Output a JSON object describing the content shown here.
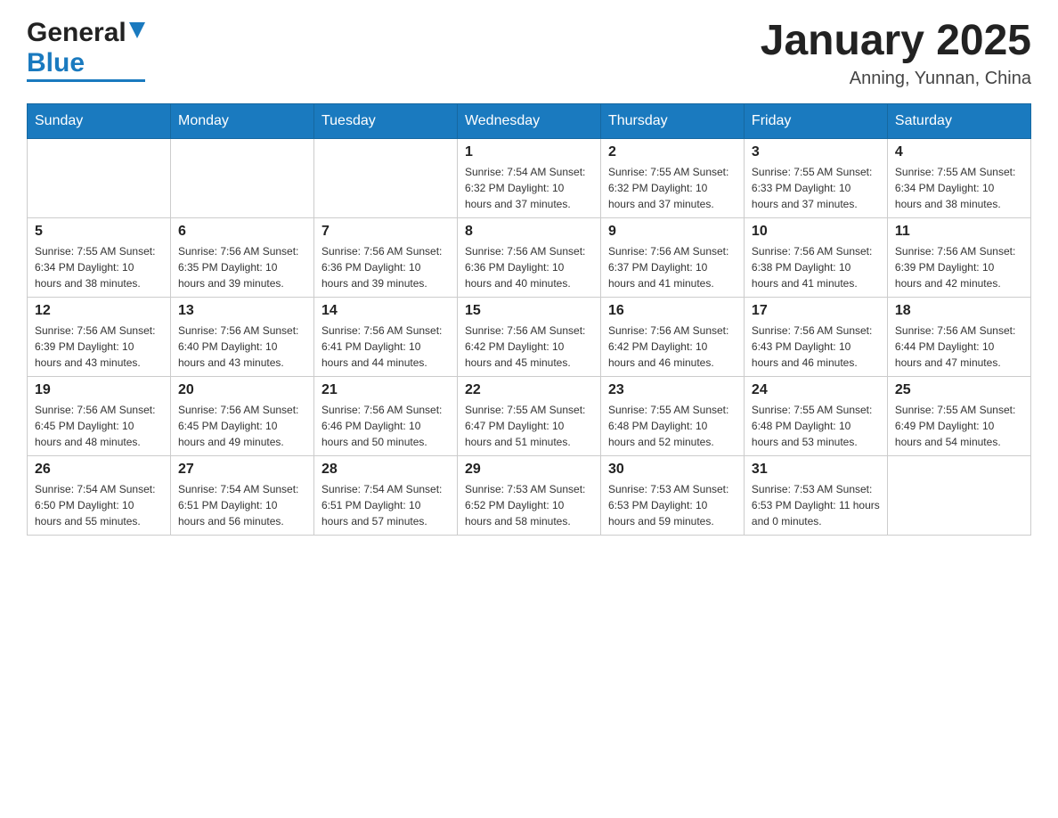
{
  "header": {
    "logo_general": "General",
    "logo_blue": "Blue",
    "title": "January 2025",
    "subtitle": "Anning, Yunnan, China"
  },
  "days_of_week": [
    "Sunday",
    "Monday",
    "Tuesday",
    "Wednesday",
    "Thursday",
    "Friday",
    "Saturday"
  ],
  "weeks": [
    [
      {
        "day": "",
        "info": ""
      },
      {
        "day": "",
        "info": ""
      },
      {
        "day": "",
        "info": ""
      },
      {
        "day": "1",
        "info": "Sunrise: 7:54 AM\nSunset: 6:32 PM\nDaylight: 10 hours\nand 37 minutes."
      },
      {
        "day": "2",
        "info": "Sunrise: 7:55 AM\nSunset: 6:32 PM\nDaylight: 10 hours\nand 37 minutes."
      },
      {
        "day": "3",
        "info": "Sunrise: 7:55 AM\nSunset: 6:33 PM\nDaylight: 10 hours\nand 37 minutes."
      },
      {
        "day": "4",
        "info": "Sunrise: 7:55 AM\nSunset: 6:34 PM\nDaylight: 10 hours\nand 38 minutes."
      }
    ],
    [
      {
        "day": "5",
        "info": "Sunrise: 7:55 AM\nSunset: 6:34 PM\nDaylight: 10 hours\nand 38 minutes."
      },
      {
        "day": "6",
        "info": "Sunrise: 7:56 AM\nSunset: 6:35 PM\nDaylight: 10 hours\nand 39 minutes."
      },
      {
        "day": "7",
        "info": "Sunrise: 7:56 AM\nSunset: 6:36 PM\nDaylight: 10 hours\nand 39 minutes."
      },
      {
        "day": "8",
        "info": "Sunrise: 7:56 AM\nSunset: 6:36 PM\nDaylight: 10 hours\nand 40 minutes."
      },
      {
        "day": "9",
        "info": "Sunrise: 7:56 AM\nSunset: 6:37 PM\nDaylight: 10 hours\nand 41 minutes."
      },
      {
        "day": "10",
        "info": "Sunrise: 7:56 AM\nSunset: 6:38 PM\nDaylight: 10 hours\nand 41 minutes."
      },
      {
        "day": "11",
        "info": "Sunrise: 7:56 AM\nSunset: 6:39 PM\nDaylight: 10 hours\nand 42 minutes."
      }
    ],
    [
      {
        "day": "12",
        "info": "Sunrise: 7:56 AM\nSunset: 6:39 PM\nDaylight: 10 hours\nand 43 minutes."
      },
      {
        "day": "13",
        "info": "Sunrise: 7:56 AM\nSunset: 6:40 PM\nDaylight: 10 hours\nand 43 minutes."
      },
      {
        "day": "14",
        "info": "Sunrise: 7:56 AM\nSunset: 6:41 PM\nDaylight: 10 hours\nand 44 minutes."
      },
      {
        "day": "15",
        "info": "Sunrise: 7:56 AM\nSunset: 6:42 PM\nDaylight: 10 hours\nand 45 minutes."
      },
      {
        "day": "16",
        "info": "Sunrise: 7:56 AM\nSunset: 6:42 PM\nDaylight: 10 hours\nand 46 minutes."
      },
      {
        "day": "17",
        "info": "Sunrise: 7:56 AM\nSunset: 6:43 PM\nDaylight: 10 hours\nand 46 minutes."
      },
      {
        "day": "18",
        "info": "Sunrise: 7:56 AM\nSunset: 6:44 PM\nDaylight: 10 hours\nand 47 minutes."
      }
    ],
    [
      {
        "day": "19",
        "info": "Sunrise: 7:56 AM\nSunset: 6:45 PM\nDaylight: 10 hours\nand 48 minutes."
      },
      {
        "day": "20",
        "info": "Sunrise: 7:56 AM\nSunset: 6:45 PM\nDaylight: 10 hours\nand 49 minutes."
      },
      {
        "day": "21",
        "info": "Sunrise: 7:56 AM\nSunset: 6:46 PM\nDaylight: 10 hours\nand 50 minutes."
      },
      {
        "day": "22",
        "info": "Sunrise: 7:55 AM\nSunset: 6:47 PM\nDaylight: 10 hours\nand 51 minutes."
      },
      {
        "day": "23",
        "info": "Sunrise: 7:55 AM\nSunset: 6:48 PM\nDaylight: 10 hours\nand 52 minutes."
      },
      {
        "day": "24",
        "info": "Sunrise: 7:55 AM\nSunset: 6:48 PM\nDaylight: 10 hours\nand 53 minutes."
      },
      {
        "day": "25",
        "info": "Sunrise: 7:55 AM\nSunset: 6:49 PM\nDaylight: 10 hours\nand 54 minutes."
      }
    ],
    [
      {
        "day": "26",
        "info": "Sunrise: 7:54 AM\nSunset: 6:50 PM\nDaylight: 10 hours\nand 55 minutes."
      },
      {
        "day": "27",
        "info": "Sunrise: 7:54 AM\nSunset: 6:51 PM\nDaylight: 10 hours\nand 56 minutes."
      },
      {
        "day": "28",
        "info": "Sunrise: 7:54 AM\nSunset: 6:51 PM\nDaylight: 10 hours\nand 57 minutes."
      },
      {
        "day": "29",
        "info": "Sunrise: 7:53 AM\nSunset: 6:52 PM\nDaylight: 10 hours\nand 58 minutes."
      },
      {
        "day": "30",
        "info": "Sunrise: 7:53 AM\nSunset: 6:53 PM\nDaylight: 10 hours\nand 59 minutes."
      },
      {
        "day": "31",
        "info": "Sunrise: 7:53 AM\nSunset: 6:53 PM\nDaylight: 11 hours\nand 0 minutes."
      },
      {
        "day": "",
        "info": ""
      }
    ]
  ]
}
